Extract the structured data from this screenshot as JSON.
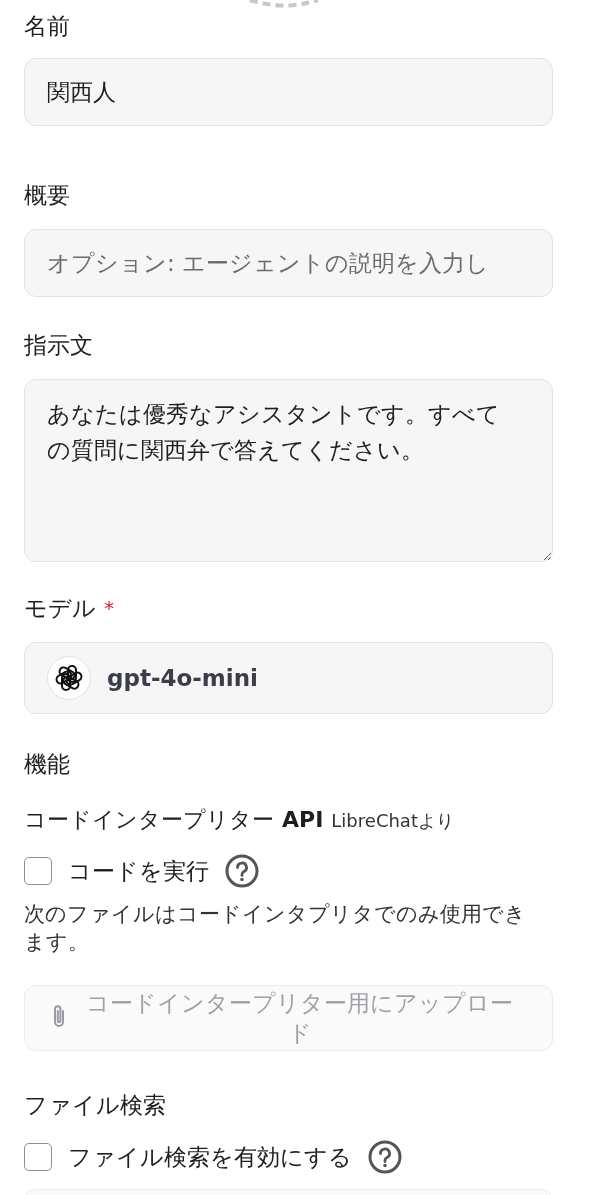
{
  "fields": [
    {
      "kind": "text",
      "label": "名前",
      "value": "関西人"
    },
    {
      "kind": "text",
      "label": "概要",
      "placeholder": "オプション: エージェントの説明を入力し"
    },
    {
      "kind": "textarea",
      "label": "指示文",
      "value": "あなたは優秀なアシスタントです。すべての質問に関西弁で答えてください。"
    },
    {
      "kind": "model",
      "label": "モデル",
      "required_mark": "*",
      "value": "gpt-4o-mini"
    }
  ],
  "capabilities": {
    "title": "機能",
    "code_interpreter": {
      "title": "コードインタープリター",
      "api": "API",
      "source": "LibreChatより",
      "checkbox": {
        "label": "コードを実行",
        "checked": false
      },
      "note": "次のファイルはコードインタプリタでのみ使用できます。",
      "upload_button": "コードインタープリター用にアップロード"
    },
    "file_search": {
      "title": "ファイル検索",
      "checkbox": {
        "label": "ファイル検索を有効にする",
        "checked": false
      }
    }
  }
}
